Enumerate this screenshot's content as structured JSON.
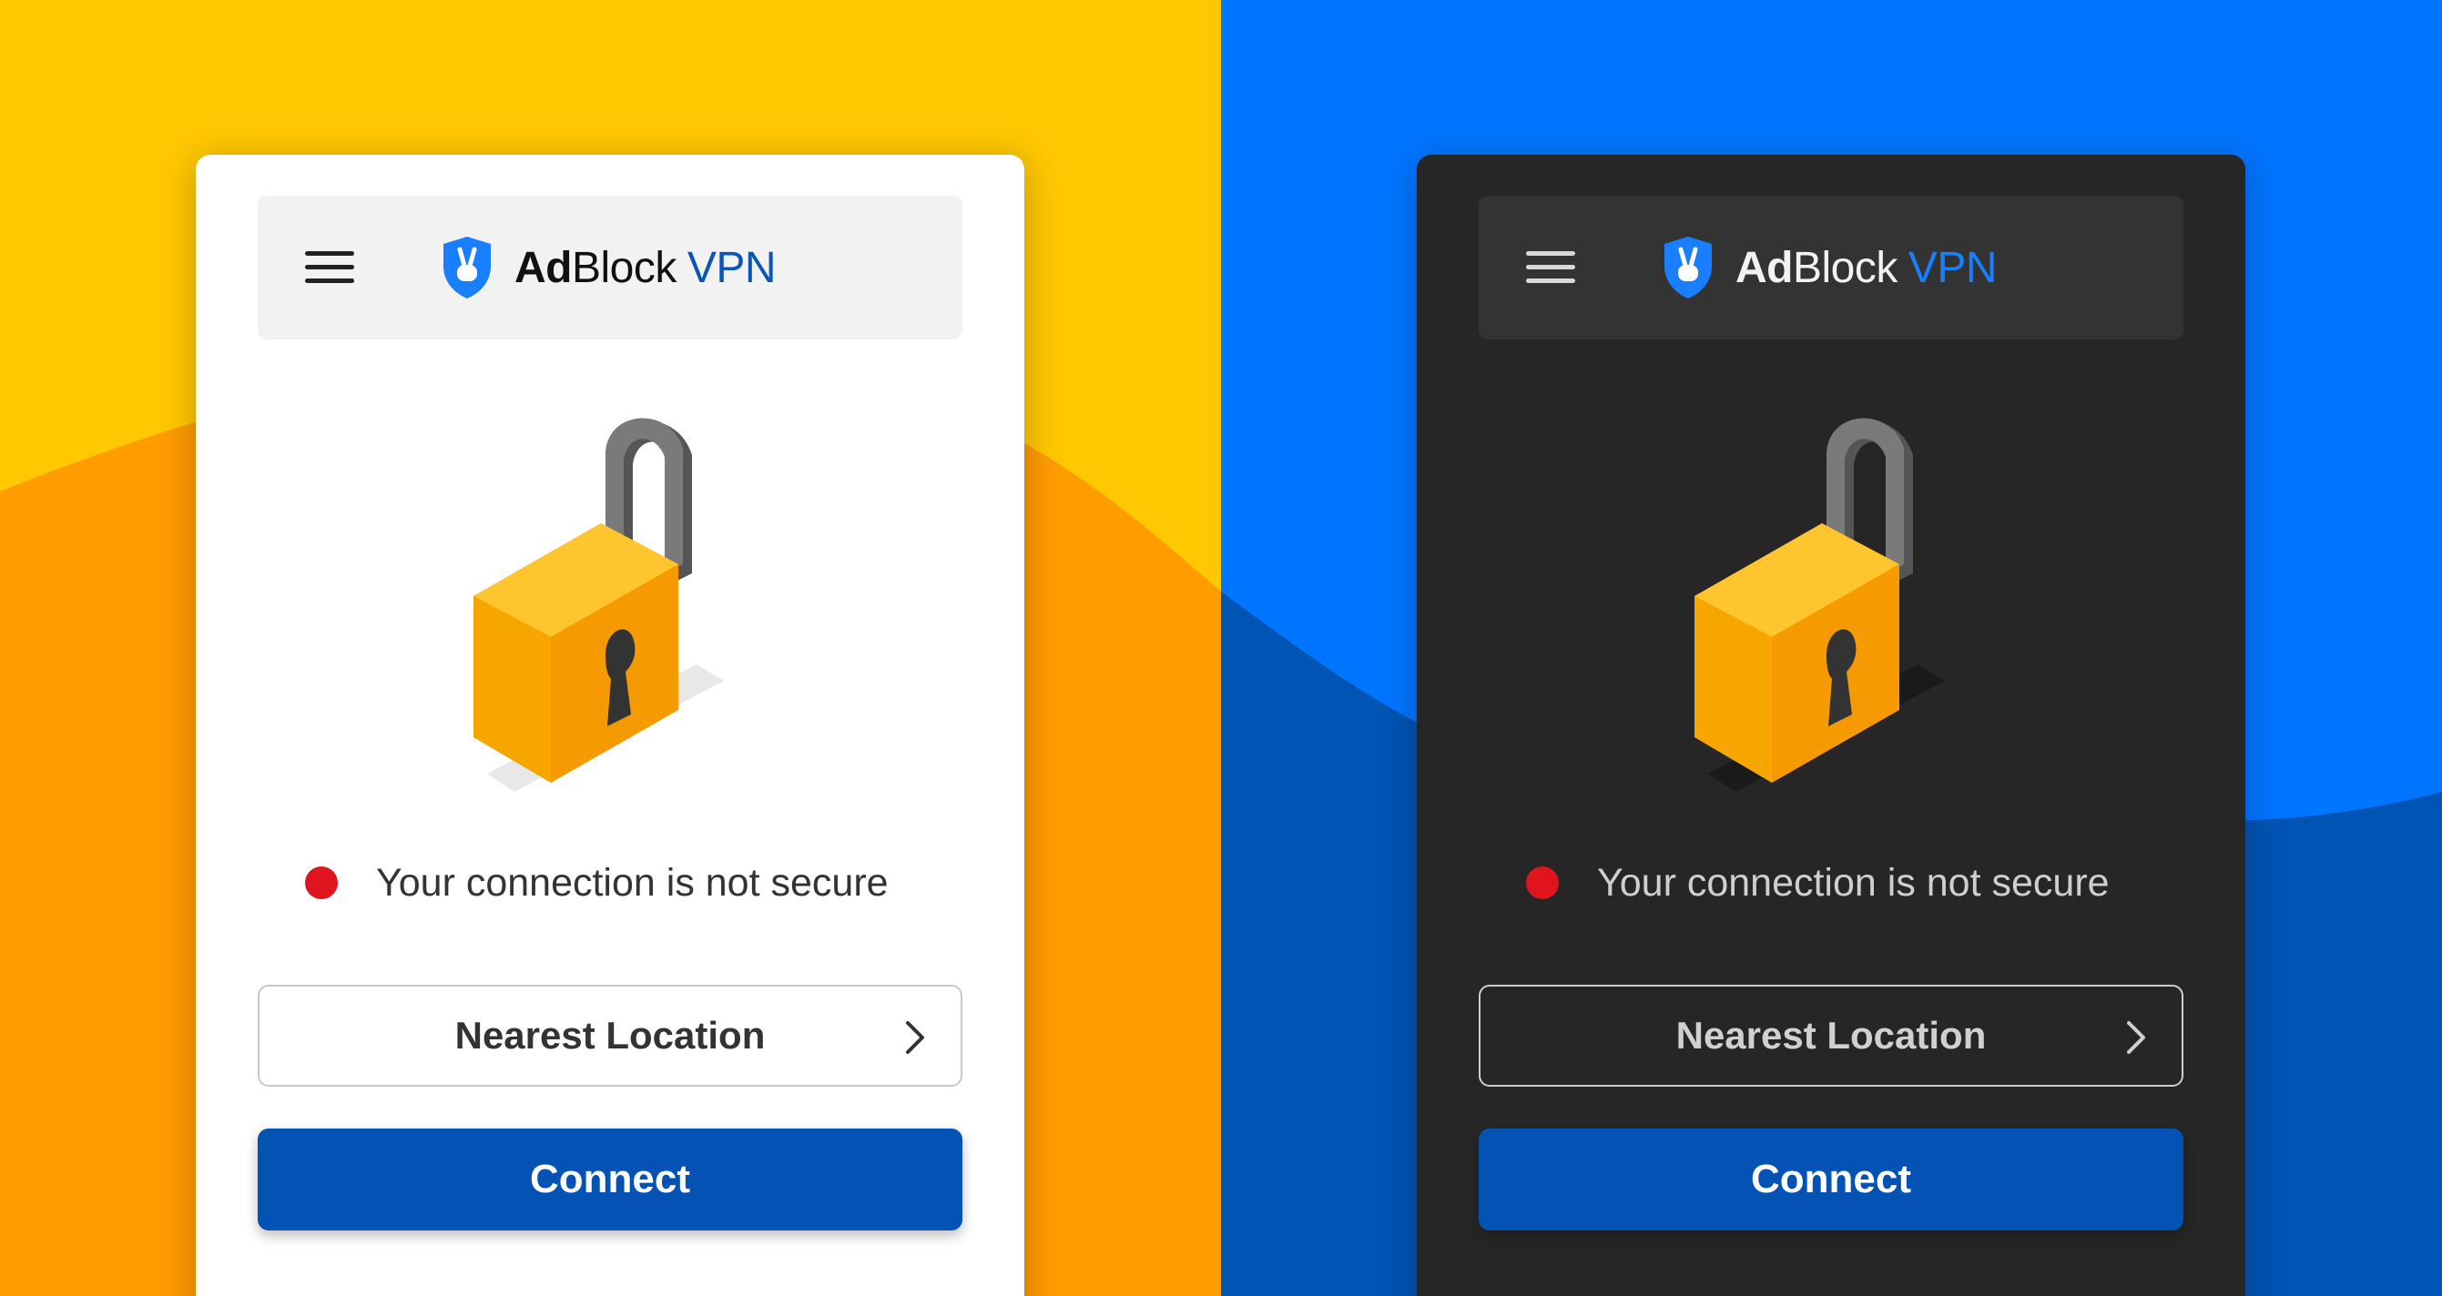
{
  "colors": {
    "left_bg_top": "#FFC800",
    "left_bg_bottom": "#FF9C00",
    "right_bg_top": "#0075FF",
    "right_bg_bottom": "#0054B4",
    "accent_blue": "#0552B5",
    "status_red": "#E0141E",
    "lock_body": "#F7A600",
    "shackle": "#6E6E6E"
  },
  "light_panel": {
    "theme": "light",
    "header": {
      "menu_icon": "hamburger-menu-icon",
      "logo_icon": "shield-peace-icon",
      "brand_part1": "Ad",
      "brand_part2": "Block",
      "brand_part3": "VPN"
    },
    "illustration": "open-padlock-icon",
    "status_text": "Your connection is not secure",
    "location_label": "Nearest Location",
    "location_icon": "chevron-right-icon",
    "connect_label": "Connect"
  },
  "dark_panel": {
    "theme": "dark",
    "header": {
      "menu_icon": "hamburger-menu-icon",
      "logo_icon": "shield-peace-icon",
      "brand_part1": "Ad",
      "brand_part2": "Block",
      "brand_part3": "VPN"
    },
    "illustration": "open-padlock-icon",
    "status_text": "Your connection is not secure",
    "location_label": "Nearest Location",
    "location_icon": "chevron-right-icon",
    "connect_label": "Connect"
  }
}
